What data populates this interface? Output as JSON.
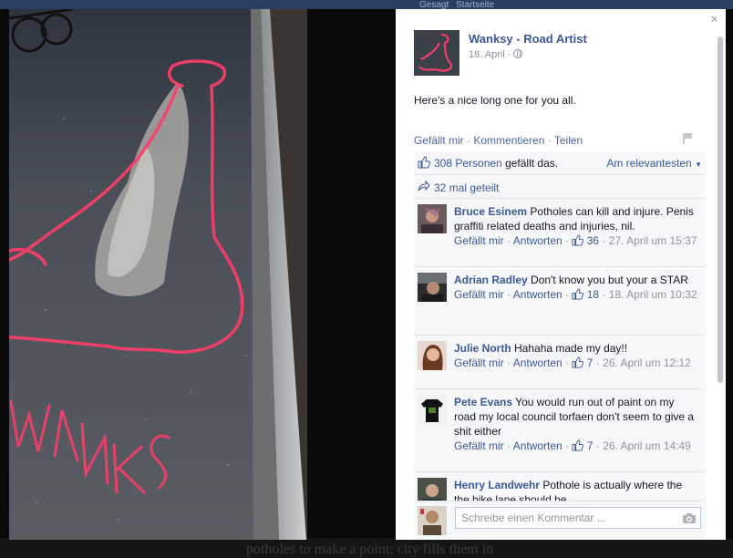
{
  "background": {
    "top_tabs": [
      "Gesagt",
      "Startseite"
    ],
    "bottom_text": "potholes to make a point; city fills them in"
  },
  "photo": {
    "painted_text": "WANKSY",
    "paint_color": "#ff3d6a"
  },
  "panel": {
    "close_glyph": "×",
    "author": "Wanksy - Road Artist",
    "date": "18. April ·",
    "post_text": "Here's a nice long one for you all.",
    "actions": {
      "like": "Gefällt mir",
      "comment": "Kommentieren",
      "share": "Teilen",
      "separator": " · "
    },
    "likes": {
      "count_text": "308 Personen",
      "suffix": " gefällt das.",
      "sort_label": "Am relevantesten"
    },
    "shares_text": "32 mal geteilt",
    "comments": [
      {
        "name": "Bruce Esinem",
        "text": "Potholes can kill and injure. Penis graffiti related deaths and injuries, nil.",
        "like": "Gefällt mir",
        "reply": "Antworten",
        "likes": "36",
        "time": "27. April um 15:37"
      },
      {
        "name": "Adrian Radley",
        "text": "Don't know you but your a STAR",
        "like": "Gefällt mir",
        "reply": "Antworten",
        "likes": "18",
        "time": "18. April um 10:32"
      },
      {
        "name": "Julie North",
        "text": "Hahaha made my day!!",
        "like": "Gefällt mir",
        "reply": "Antworten",
        "likes": "7",
        "time": "26. April um 12:12"
      },
      {
        "name": "Pete Evans",
        "text": "You would run out of paint on my road my local council torfaen don't seem to give a shit either",
        "like": "Gefällt mir",
        "reply": "Antworten",
        "likes": "7",
        "time": "26. April um 14:49"
      },
      {
        "name": "Henry Landwehr",
        "text": "Pothole is actually where the the bike lane should be .",
        "like": "",
        "reply": "",
        "likes": "",
        "time": ""
      }
    ],
    "write_placeholder": "Schreibe einen Kommentar ..."
  },
  "colors": {
    "link": "#3b5998",
    "meta": "#90949c",
    "box_bg": "#f6f7f9"
  }
}
